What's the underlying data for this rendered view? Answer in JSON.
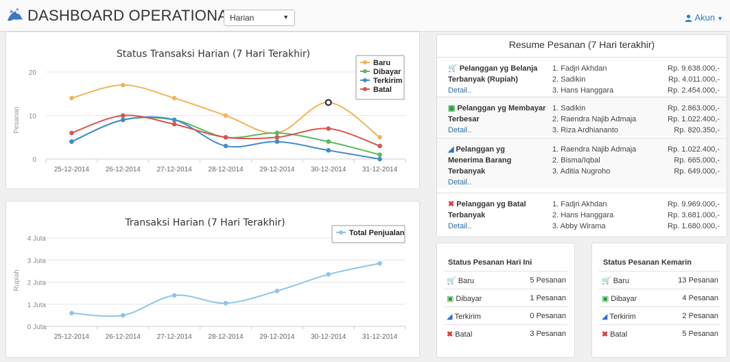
{
  "header": {
    "title": "DASHBOARD OPERATIONAL",
    "period": "Harian",
    "account": "Akun"
  },
  "status_chart": {
    "title": "Status Transaksi Harian (7 Hari Terakhir)",
    "ylabel": "Pesanan",
    "y_ticks": [
      "0",
      "10",
      "20"
    ],
    "chart_data": {
      "type": "line",
      "title": "Status Transaksi Harian (7 Hari Terakhir)",
      "ylabel": "Pesanan",
      "ylim": [
        0,
        20
      ],
      "legend": "top-right",
      "categories": [
        "25-12-2014",
        "26-12-2014",
        "27-12-2014",
        "28-12-2014",
        "29-12-2014",
        "30-12-2014",
        "31-12-2014"
      ],
      "series": [
        {
          "name": "Baru",
          "color": "#f0b55a",
          "values": [
            14,
            17,
            14,
            10,
            6,
            13,
            5
          ]
        },
        {
          "name": "Dibayar",
          "color": "#5cb85c",
          "values": [
            4,
            9,
            9,
            5,
            6,
            4,
            1
          ]
        },
        {
          "name": "Terkirim",
          "color": "#428bca",
          "values": [
            4,
            9,
            9,
            3,
            4,
            2,
            0
          ]
        },
        {
          "name": "Batal",
          "color": "#d9534f",
          "values": [
            6,
            10,
            8,
            5,
            5,
            7,
            3
          ]
        }
      ]
    }
  },
  "sales_chart": {
    "title": "Transaksi Harian (7 Hari Terakhir)",
    "ylabel": "Rupiah",
    "y_ticks": [
      "0 Juta",
      "1 Juta",
      "2 Juta",
      "3 Juta",
      "4 Juta"
    ],
    "chart_data": {
      "type": "line",
      "title": "Transaksi Harian (7 Hari Terakhir)",
      "ylabel": "Rupiah",
      "ylim": [
        0,
        4
      ],
      "legend": "top-right",
      "categories": [
        "25-12-2014",
        "26-12-2014",
        "27-12-2014",
        "28-12-2014",
        "29-12-2014",
        "30-12-2014",
        "31-12-2014"
      ],
      "series": [
        {
          "name": "Total Penjualan",
          "color": "#8fc3e8",
          "values": [
            0.6,
            0.5,
            1.4,
            1.05,
            1.6,
            2.35,
            2.85
          ]
        }
      ]
    }
  },
  "resume": {
    "title": "Resume Pesanan (7 Hari terakhir)",
    "sections": [
      {
        "icon": "cart-icon",
        "label": "Pelanggan yg Belanja Terbanyak (Rupiah)",
        "detail": "Detail..",
        "rows": [
          {
            "name": "1. Fadjri Akhdan",
            "value": "Rp. 9.638.000,-"
          },
          {
            "name": "2. Sadikin",
            "value": "Rp. 4.011.000,-"
          },
          {
            "name": "3. Hans Hanggara",
            "value": "Rp. 2.454.000,-"
          }
        ]
      },
      {
        "icon": "money-icon",
        "label": "Pelanggan yg Membayar Terbesar",
        "detail": "Detail..",
        "rows": [
          {
            "name": "1. Sadikin",
            "value": "Rp. 2.863.000,-"
          },
          {
            "name": "2. Raendra Najib Admaja",
            "value": "Rp. 1.022.400,-"
          },
          {
            "name": "3. Riza Ardhiananto",
            "value": "Rp. 820.350,-"
          }
        ]
      },
      {
        "icon": "plane-icon",
        "label": "Pelanggan yg Menerima Barang Terbanyak",
        "detail": "Detail..",
        "rows": [
          {
            "name": "1. Raendra Najib Admaja",
            "value": "Rp. 1.022.400,-"
          },
          {
            "name": "2. Bisma/Iqbal",
            "value": "Rp. 665.000,-"
          },
          {
            "name": "3. Aditia Nugroho",
            "value": "Rp. 649.000,-"
          }
        ]
      },
      {
        "icon": "x-icon",
        "label": "Pelanggan yg Batal Terbanyak",
        "detail": "Detail..",
        "rows": [
          {
            "name": "1. Fadjri Akhdan",
            "value": "Rp. 9.969.000,-"
          },
          {
            "name": "2. Hans Hanggara",
            "value": "Rp. 3.681.000,-"
          },
          {
            "name": "3. Abby Wirama",
            "value": "Rp. 1.680.000,-"
          }
        ]
      }
    ]
  },
  "status_today": {
    "title": "Status Pesanan Hari Ini",
    "rows": [
      {
        "icon": "cart-icon",
        "label": "Baru",
        "count": "5 Pesanan"
      },
      {
        "icon": "money-icon",
        "label": "Dibayar",
        "count": "1 Pesanan"
      },
      {
        "icon": "plane-icon",
        "label": "Terkirim",
        "count": "0 Pesanan"
      },
      {
        "icon": "x-icon",
        "label": "Batal",
        "count": "3 Pesanan"
      }
    ]
  },
  "status_yesterday": {
    "title": "Status Pesanan Kemarin",
    "rows": [
      {
        "icon": "cart-icon",
        "label": "Baru",
        "count": "13 Pesanan"
      },
      {
        "icon": "money-icon",
        "label": "Dibayar",
        "count": "4 Pesanan"
      },
      {
        "icon": "plane-icon",
        "label": "Terkirim",
        "count": "2 Pesanan"
      },
      {
        "icon": "x-icon",
        "label": "Batal",
        "count": "5 Pesanan"
      }
    ]
  }
}
